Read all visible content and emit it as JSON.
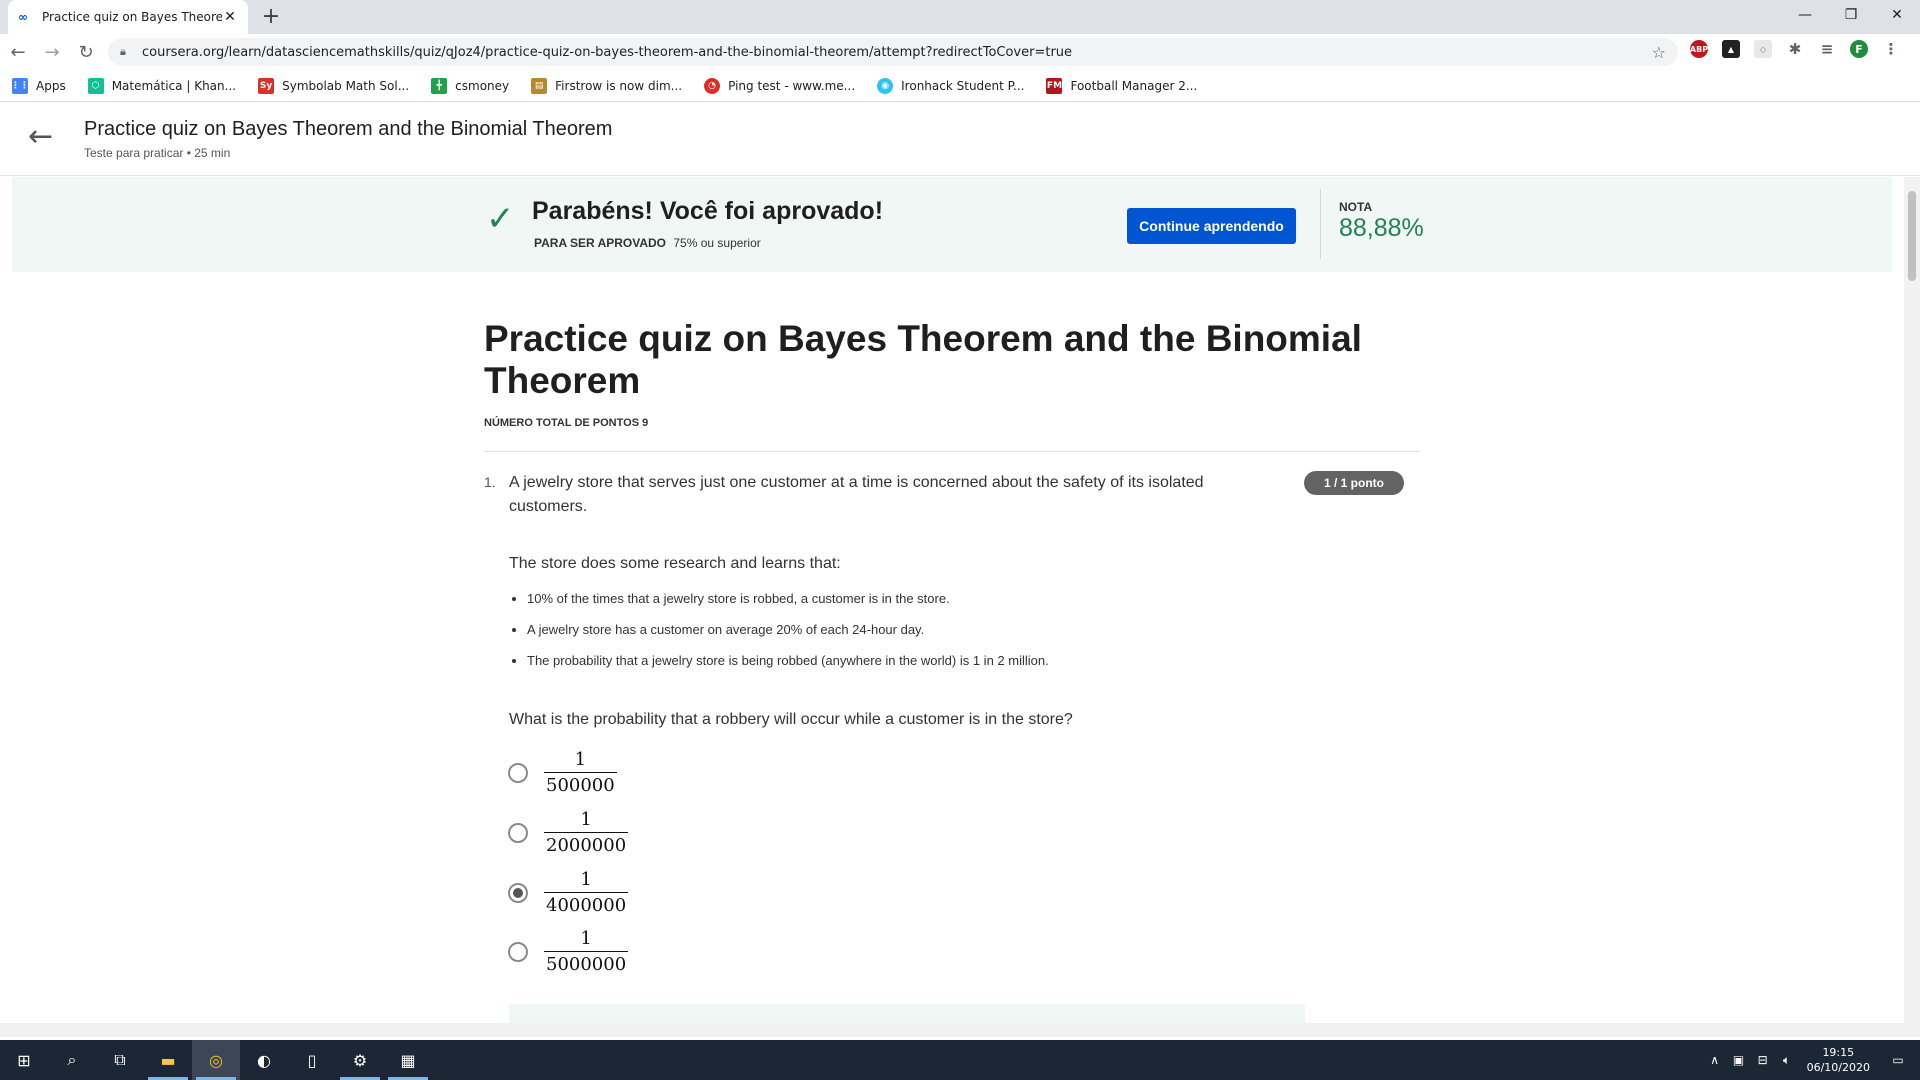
{
  "browser": {
    "tab_title": "Practice quiz on Bayes Theorem a",
    "tab_close": "✕",
    "new_tab": "+",
    "url": "coursera.org/learn/datasciencemathskills/quiz/qJoz4/practice-quiz-on-bayes-theorem-and-the-binomial-theorem/attempt?redirectToCover=true",
    "bookmarks": [
      {
        "label": "Apps",
        "icon": "apps-grid-icon",
        "color": "#4285f4"
      },
      {
        "label": "Matemática | Khan...",
        "icon": "khan-academy-icon",
        "color": "#14bf96"
      },
      {
        "label": "Symbolab Math Sol...",
        "icon": "symbolab-icon",
        "color": "#d9302a"
      },
      {
        "label": "csmoney",
        "icon": "csmoney-icon",
        "color": "#1fa24a"
      },
      {
        "label": "Firstrow is now dim...",
        "icon": "firstrow-icon",
        "color": "#b5892c"
      },
      {
        "label": "Ping test - www.me...",
        "icon": "ping-test-icon",
        "color": "#d9302a"
      },
      {
        "label": "Ironhack Student P...",
        "icon": "ironhack-icon",
        "color": "#2ec4f0"
      },
      {
        "label": "Football Manager 2...",
        "icon": "football-manager-icon",
        "color": "#b0161c"
      }
    ],
    "profile_initial": "F"
  },
  "header": {
    "title": "Practice quiz on Bayes Theorem and the Binomial Theorem",
    "subtitle": "Teste para praticar • 25 min"
  },
  "result": {
    "title": "Parabéns! Você foi aprovado!",
    "requirement_label": "PARA SER APROVADO",
    "requirement_value": "75% ou superior",
    "continue_label": "Continue aprendendo",
    "grade_label": "NOTA",
    "grade_value": "88,88%",
    "accent_color": "#1f8354",
    "button_color": "#0056d2"
  },
  "quiz": {
    "title": "Practice quiz on Bayes Theorem and the Binomial Theorem",
    "total_points": "NÚMERO TOTAL DE PONTOS 9"
  },
  "question1": {
    "number": "1.",
    "text": "A jewelry store that serves just one customer at a time is concerned about the safety of its isolated customers.",
    "points": "1 / 1 ponto",
    "research": "The store does some research and learns that:",
    "facts": [
      "10% of the times that a jewelry store is robbed, a customer is in the store.",
      "A jewelry store has a customer on average 20% of each 24-hour day.",
      "The probability that a jewelry store is being robbed (anywhere in the world) is 1 in 2 million."
    ],
    "question": "What is the probability that a robbery will occur while a customer is in the store?",
    "options": [
      {
        "numerator": "1",
        "denominator": "500000",
        "selected": false
      },
      {
        "numerator": "1",
        "denominator": "2000000",
        "selected": false
      },
      {
        "numerator": "1",
        "denominator": "4000000",
        "selected": true
      },
      {
        "numerator": "1",
        "denominator": "5000000",
        "selected": false
      }
    ]
  },
  "taskbar": {
    "time": "19:15",
    "date": "06/10/2020"
  }
}
